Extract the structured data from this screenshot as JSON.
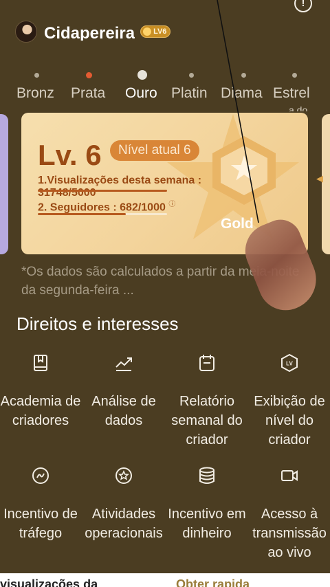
{
  "header": {
    "info_icon": "info-icon",
    "username": "Cidapereira",
    "level_badge": "LV6"
  },
  "tiers": [
    "Bronz",
    "Prata",
    "Ouro",
    "Platin",
    "Diama",
    "Estrel"
  ],
  "tier_sub": "a do",
  "card": {
    "level": "Lv. 6",
    "current": "Nível atual 6",
    "req1_label": "1.Visualizações desta semana :",
    "req1_value": "31748/5000",
    "req2_label": "2. Seguidores : 682/1000",
    "req2_icon": "help-icon",
    "followers_progress": 0.682,
    "tier_name": "Gold"
  },
  "note": "*Os dados são calculados a partir da meia-noite da segunda-feira ...",
  "rights": {
    "title": "Direitos e interesses",
    "items": [
      {
        "label": "Academia de criadores",
        "icon": "book-icon"
      },
      {
        "label": "Análise de dados",
        "icon": "trend-chart-icon"
      },
      {
        "label": "Relatório semanal do criador",
        "icon": "calendar-report-icon"
      },
      {
        "label": "Exibição de nível do criador",
        "icon": "lv-shield-icon"
      },
      {
        "label": "Incentivo de tráfego",
        "icon": "traffic-drop-icon"
      },
      {
        "label": "Atividades operacionais",
        "icon": "star-circle-icon"
      },
      {
        "label": "Incentivo em dinheiro",
        "icon": "coin-stack-icon"
      },
      {
        "label": "Acesso à transmissão ao vivo",
        "icon": "video-camera-icon"
      }
    ]
  },
  "bottom": {
    "left": "visualizações da",
    "right": "Obter rapida"
  },
  "colors": {
    "background": "#4b3d22",
    "card": "#f3d49c",
    "accent": "#9a4a14",
    "active_dot": "#e35b32"
  }
}
